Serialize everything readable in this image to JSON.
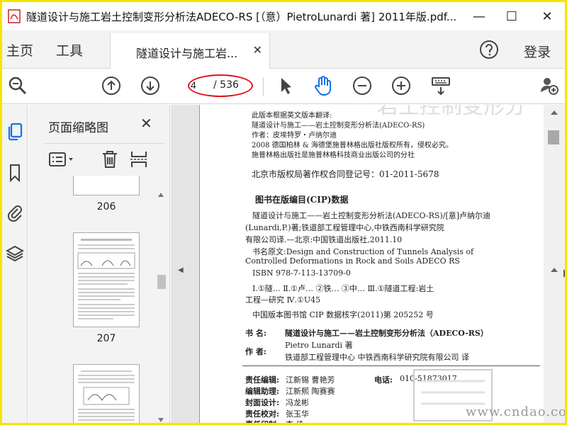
{
  "window": {
    "title": "隧道设计与施工岩土控制变形分析法ADECO-RS [（意）PietroLunardi 著] 2011年版.pdf...",
    "minimize": "—",
    "maximize": "☐",
    "close": "✕"
  },
  "tabs": {
    "home": "主页",
    "tools": "工具",
    "document": "隧道设计与施工岩...",
    "document_close": "✕",
    "login": "登录"
  },
  "toolbar": {
    "page_current": "4",
    "page_total": "/ 536"
  },
  "thumbnails": {
    "title": "页面缩略图",
    "close": "✕",
    "pages": [
      {
        "number": "206"
      },
      {
        "number": "207"
      },
      {
        "number": ""
      }
    ]
  },
  "document": {
    "lines": [
      "此版本根据英文版本翻译:",
      "隧道设计与施工——岩土控制变形分析法(ADECO-RS)",
      "作者：皮埃特罗・卢纳尔迪",
      "2008 德国柏林 & 海德堡施普林格出版社版权所有，侵权必究。",
      "施普林格出版社是施普林格科技商业出版公司的分社",
      "北京市版权局著作权合同登记号：01-2011-5678",
      "图书在版编目(CIP)数据",
      "隧道设计与施工——岩土控制变形分析法(ADECO-RS)/[意]卢纳尔迪",
      "(Lunardi,P.)著;铁道部工程管理中心,中铁西南科学研究院",
      "有限公司译.—北京:中国铁道出版社,2011.10",
      "书名原文:Design and Construction of Tunnels Analysis of",
      "Controlled Deformations in Rock and Soils ADECO RS",
      "ISBN 978-7-113-13709-0",
      "Ⅰ.①隧…  Ⅱ.①卢…  ②铁…  ③中…  Ⅲ.①隧道工程:岩土",
      "工程—研究  Ⅳ.①U45",
      "中国版本图书馆 CIP 数据核字(2011)第 205252 号"
    ],
    "book_label": "书     名:",
    "book_value": "隧道设计与施工——岩土控制变形分析法（ADECO-RS）",
    "author_label": "作     者:",
    "author_value_1": "Pietro Lunardi   著",
    "author_value_2": "铁道部工程管理中心   中铁西南科学研究院有限公司   译",
    "editor_label": "责任编辑:",
    "editor_value": "江新锡   曹艳芳",
    "phone_label": "电话:",
    "phone_value": "010-51873017",
    "assistant_label": "编辑助理:",
    "assistant_value": "江新熙   陶赛赛",
    "cover_label": "封面设计:",
    "cover_value": "冯龙彬",
    "proof_label": "责任校对:",
    "proof_value": "张玉华",
    "print_label": "责任印制:",
    "print_value": "李   佳"
  },
  "watermark": "www.cndao.com",
  "colors": {
    "frame": "#f5e500",
    "ellipse": "#e0141f",
    "rail_active": "#1473e6"
  }
}
